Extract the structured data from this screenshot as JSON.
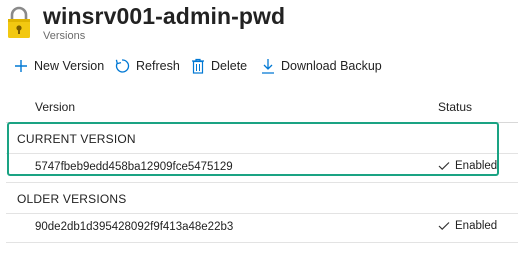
{
  "header": {
    "title": "winsrv001-admin-pwd",
    "subtitle": "Versions",
    "icon": "key-lock-icon"
  },
  "toolbar": {
    "new_version": {
      "label": "New Version",
      "icon": "plus-icon"
    },
    "refresh": {
      "label": "Refresh",
      "icon": "refresh-icon"
    },
    "delete": {
      "label": "Delete",
      "icon": "trash-icon"
    },
    "download_backup": {
      "label": "Download Backup",
      "icon": "download-icon"
    }
  },
  "table": {
    "columns": {
      "version": "Version",
      "status": "Status"
    },
    "current_group": "CURRENT VERSION",
    "older_group": "OLDER VERSIONS",
    "current_rows": [
      {
        "version": "5747fbeb9edd458ba12909fce5475129",
        "status": "Enabled"
      }
    ],
    "older_rows": [
      {
        "version": "90de2db1d395428092f9f413a48e22b3",
        "status": "Enabled"
      }
    ]
  },
  "colors": {
    "accent": "#0078d4",
    "highlight": "#1aa383",
    "key_gold": "#f2c811"
  }
}
